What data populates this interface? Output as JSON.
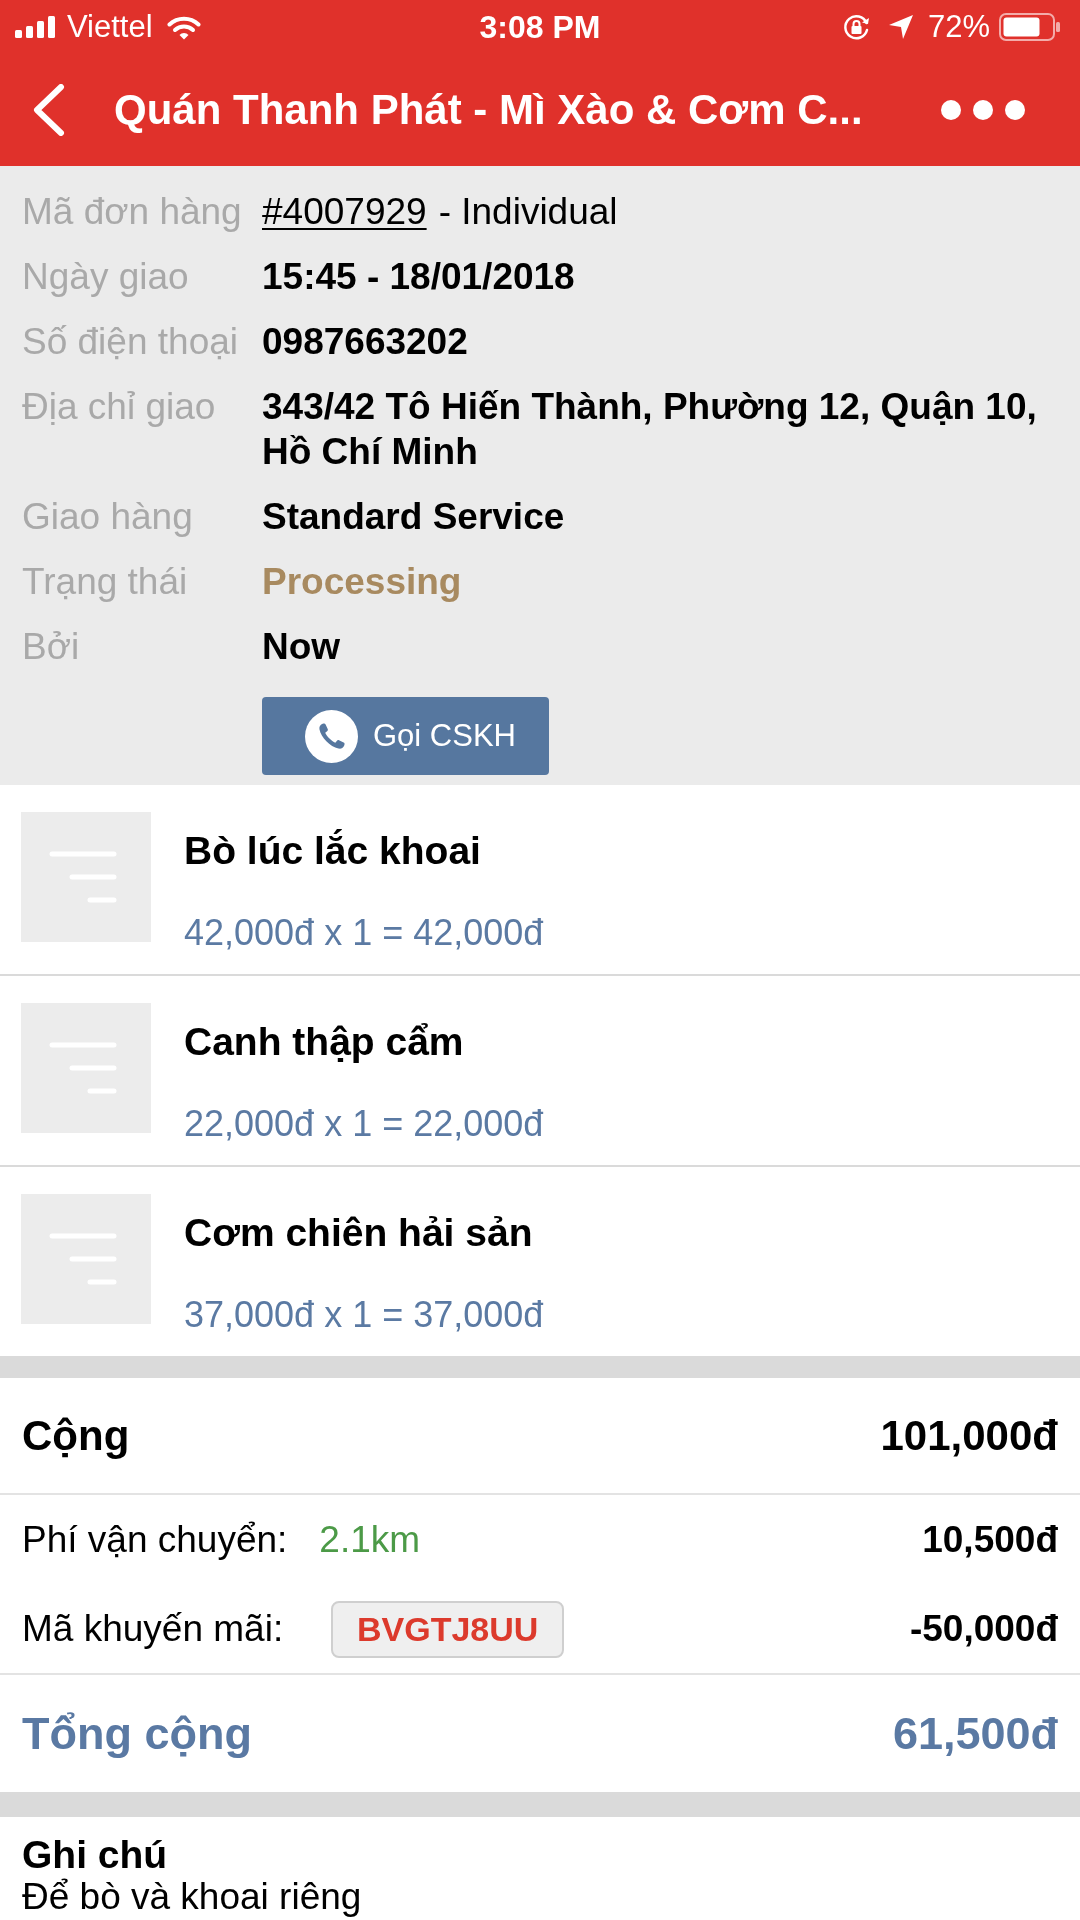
{
  "status_bar": {
    "carrier": "Viettel",
    "time": "3:08 PM",
    "battery": "72%"
  },
  "header": {
    "title": "Quán Thanh Phát - Mì Xào & Cơm C..."
  },
  "order_info": {
    "rows": [
      {
        "kind": "order",
        "label": "Mã đơn hàng",
        "value": "#4007929",
        "note": "- Individual"
      },
      {
        "kind": "text",
        "label": "Ngày giao",
        "value": "15:45 - 18/01/2018"
      },
      {
        "kind": "text",
        "label": "Số điện thoại",
        "value": "0987663202"
      },
      {
        "kind": "text",
        "label": "Địa chỉ giao",
        "value": "343/42 Tô Hiến Thành, Phường 12, Quận 10, Hồ Chí Minh"
      },
      {
        "kind": "text",
        "label": "Giao hàng",
        "value": "Standard Service"
      },
      {
        "kind": "status",
        "label": "Trạng thái",
        "value": "Processing"
      },
      {
        "kind": "text",
        "label": "Bởi",
        "value": "Now"
      }
    ],
    "call_button": {
      "label": "Gọi CSKH"
    }
  },
  "items": [
    {
      "name": "Bò lúc lắc khoai",
      "price": "42,000đ x 1 = 42,000đ"
    },
    {
      "name": "Canh thập cẩm",
      "price": "22,000đ x 1 = 22,000đ"
    },
    {
      "name": "Cơm chiên hải sản",
      "price": "37,000đ x 1 = 37,000đ"
    }
  ],
  "summary": {
    "subtotal": {
      "label": "Cộng",
      "amount": "101,000đ"
    },
    "shipping": {
      "label": "Phí vận chuyển:",
      "distance": "2.1km",
      "amount": "10,500đ"
    },
    "promo": {
      "label": "Mã khuyến mãi:",
      "code": "BVGTJ8UU",
      "amount": "-50,000đ"
    },
    "total": {
      "label": "Tổng cộng",
      "amount": "61,500đ"
    }
  },
  "note": {
    "title": "Ghi chú",
    "text": "Để bò và khoai riêng"
  }
}
